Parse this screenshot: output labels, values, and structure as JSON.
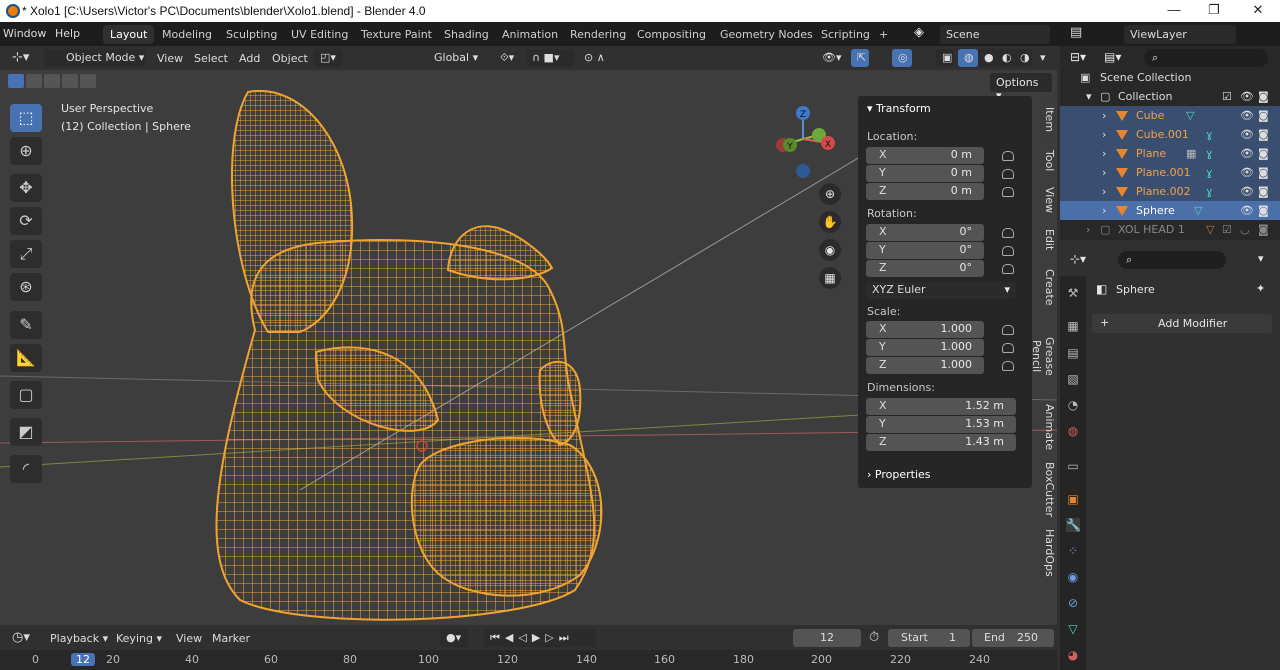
{
  "titlebar": {
    "title": "* Xolo1 [C:\\Users\\Victor's PC\\Documents\\blender\\Xolo1.blend] - Blender 4.0",
    "minimize": "—",
    "maximize": "❐",
    "close": "✕"
  },
  "menu": {
    "window": "Window",
    "help": "Help"
  },
  "workspaces": [
    "Layout",
    "Modeling",
    "Sculpting",
    "UV Editing",
    "Texture Paint",
    "Shading",
    "Animation",
    "Rendering",
    "Compositing",
    "Geometry Nodes",
    "Scripting",
    "+"
  ],
  "scene": "Scene",
  "view_layer": "ViewLayer",
  "viewport_header": {
    "mode": "Object Mode",
    "view": "View",
    "select": "Select",
    "add": "Add",
    "object": "Object",
    "orientation": "Global",
    "options": "Options"
  },
  "viewport": {
    "perspective": "User Perspective",
    "collection_info": "(12) Collection | Sphere"
  },
  "gizmo": {
    "z": "Z",
    "y": "Y",
    "x": "X"
  },
  "transform": {
    "header": "Transform",
    "location_label": "Location:",
    "location": [
      {
        "axis": "X",
        "value": "0 m"
      },
      {
        "axis": "Y",
        "value": "0 m"
      },
      {
        "axis": "Z",
        "value": "0 m"
      }
    ],
    "rotation_label": "Rotation:",
    "rotation": [
      {
        "axis": "X",
        "value": "0°"
      },
      {
        "axis": "Y",
        "value": "0°"
      },
      {
        "axis": "Z",
        "value": "0°"
      }
    ],
    "rotation_mode": "XYZ Euler",
    "scale_label": "Scale:",
    "scale": [
      {
        "axis": "X",
        "value": "1.000"
      },
      {
        "axis": "Y",
        "value": "1.000"
      },
      {
        "axis": "Z",
        "value": "1.000"
      }
    ],
    "dimensions_label": "Dimensions:",
    "dimensions": [
      {
        "axis": "X",
        "value": "1.52 m"
      },
      {
        "axis": "Y",
        "value": "1.53 m"
      },
      {
        "axis": "Z",
        "value": "1.43 m"
      }
    ],
    "properties": "Properties"
  },
  "side_tabs": [
    "Item",
    "Tool",
    "View",
    "Edit",
    "Create",
    "Grease Pencil",
    "Animate",
    "BoxCutter",
    "HardOps"
  ],
  "outliner": {
    "scene_collection": "Scene Collection",
    "collection": "Collection",
    "items": [
      {
        "name": "Cube"
      },
      {
        "name": "Cube.001"
      },
      {
        "name": "Plane"
      },
      {
        "name": "Plane.001"
      },
      {
        "name": "Plane.002"
      },
      {
        "name": "Sphere"
      }
    ],
    "xol_head": "XOL HEAD 1"
  },
  "properties": {
    "object_name": "Sphere",
    "add_modifier": "Add Modifier"
  },
  "timeline": {
    "playback": "Playback",
    "keying": "Keying",
    "view": "View",
    "marker": "Marker",
    "current_frame": "12",
    "start_label": "Start",
    "start": "1",
    "end_label": "End",
    "end": "250"
  },
  "ruler": [
    "0",
    "12",
    "20",
    "40",
    "60",
    "80",
    "100",
    "120",
    "140",
    "160",
    "180",
    "200",
    "220",
    "240"
  ],
  "colors": {
    "accent": "#4772b3",
    "wire": "#f0a430",
    "selected_row": "#4b6fa8"
  }
}
